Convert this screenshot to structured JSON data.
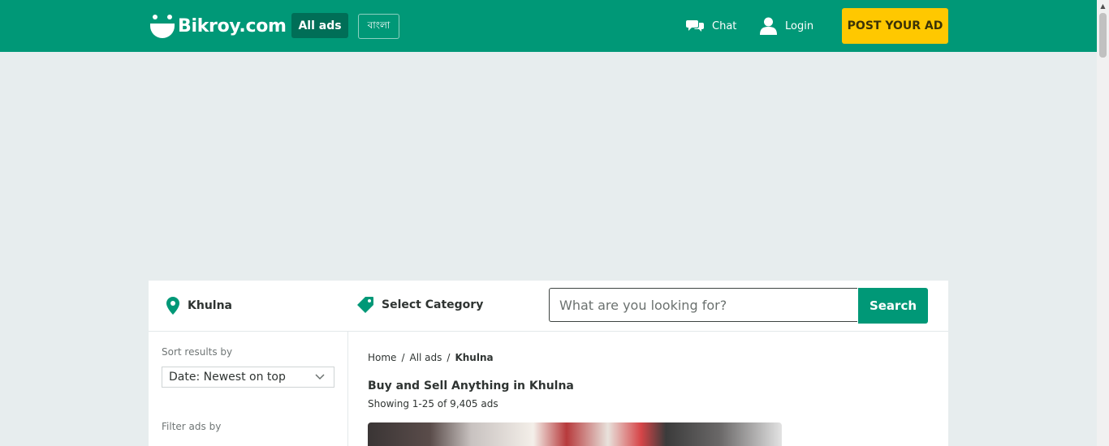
{
  "header": {
    "logo_text": "Bikroy.com",
    "all_ads": "All ads",
    "language": "বাংলা",
    "chat": "Chat",
    "login": "Login",
    "post_ad": "POST YOUR AD"
  },
  "search": {
    "location": "Khulna",
    "category": "Select Category",
    "placeholder": "What are you looking for?",
    "button": "Search"
  },
  "sidebar": {
    "sort_label": "Sort results by",
    "sort_value": "Date: Newest on top",
    "filter_label": "Filter ads by"
  },
  "main": {
    "breadcrumb": [
      "Home",
      "All ads",
      "Khulna"
    ],
    "title": "Buy and Sell Anything in Khulna",
    "showing": "Showing 1-25 of 9,405 ads"
  },
  "colors": {
    "brand": "#009877",
    "post_button": "#ffc800",
    "background": "#e7edee"
  },
  "icons": [
    "bikroy-logo-icon",
    "chat-icon",
    "user-icon",
    "location-pin-icon",
    "tag-icon",
    "chevron-down-icon"
  ]
}
